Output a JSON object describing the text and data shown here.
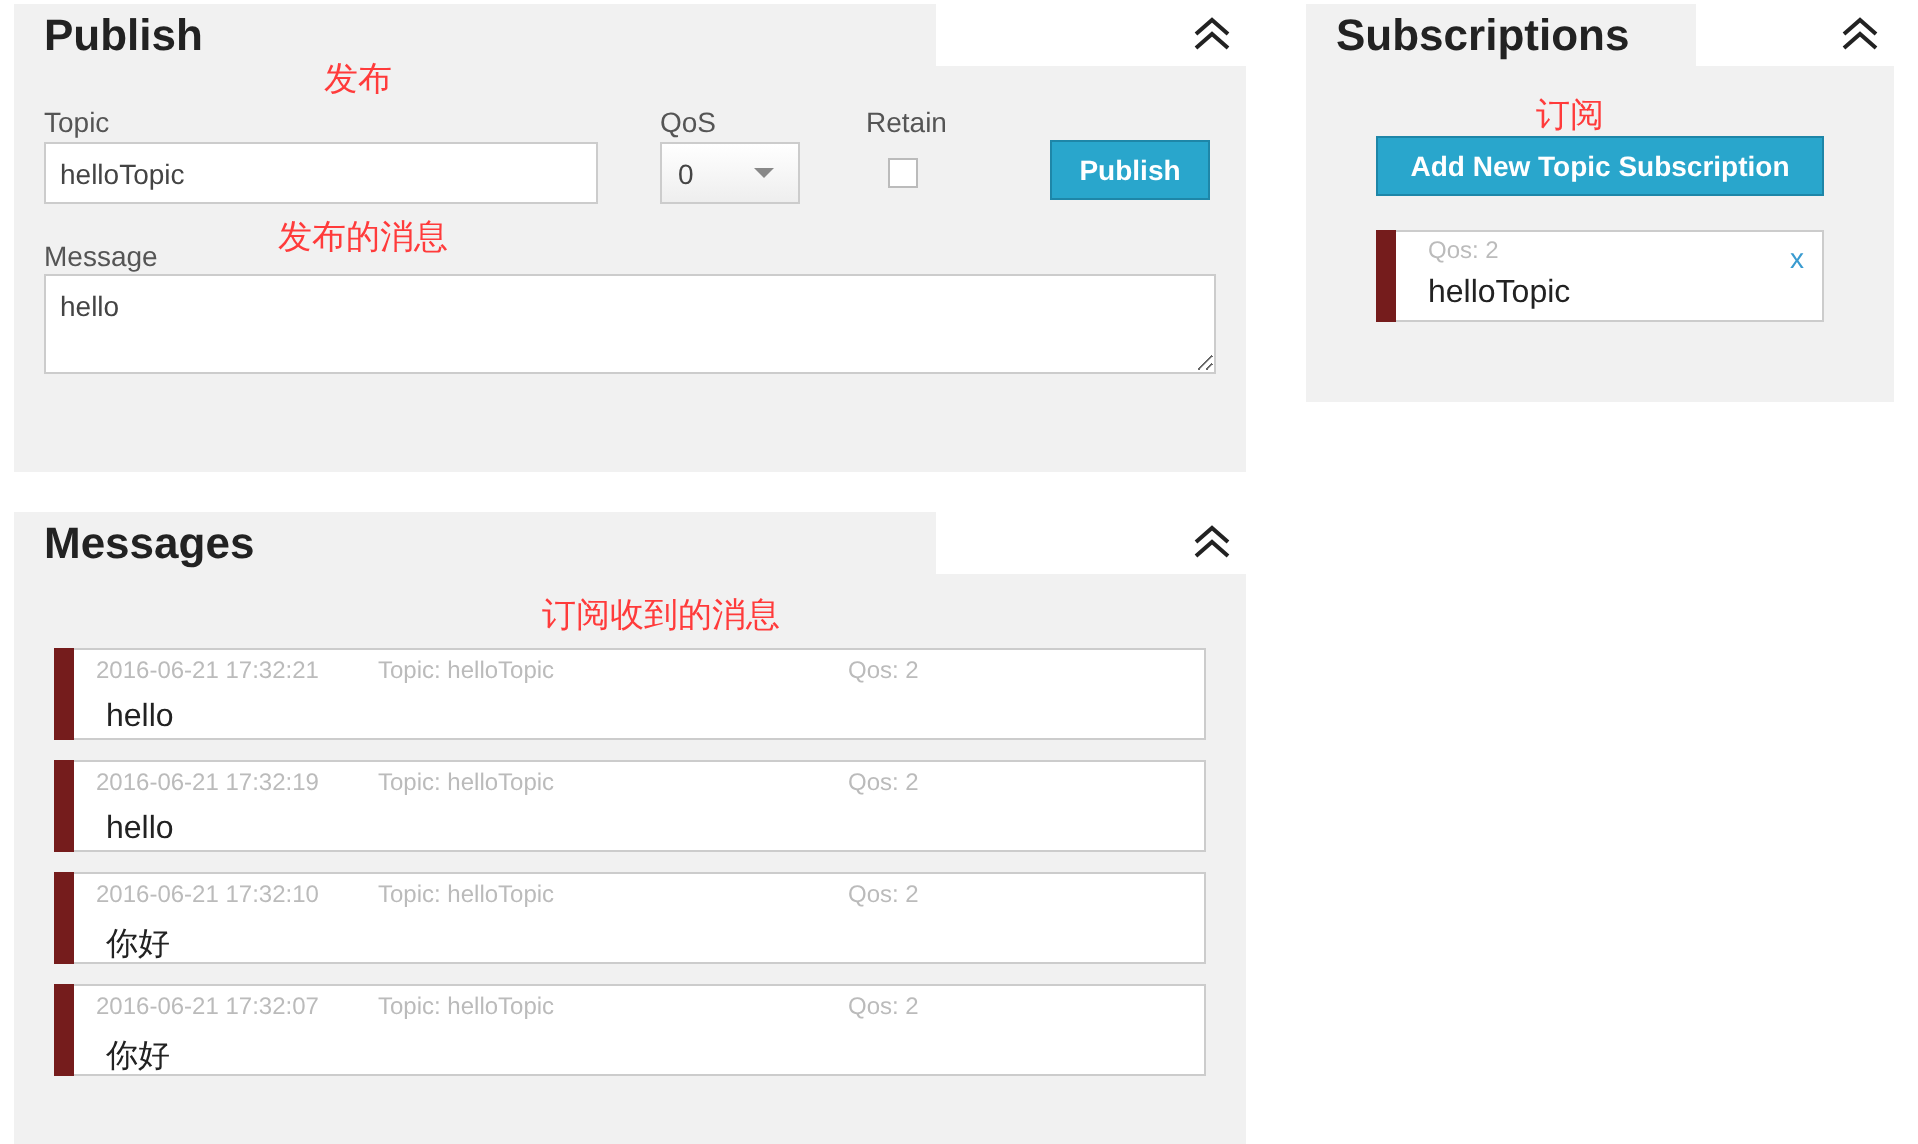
{
  "publish": {
    "title": "Publish",
    "annotation": "发布",
    "topic": {
      "label": "Topic",
      "value": "helloTopic"
    },
    "qos": {
      "label": "QoS",
      "value": "0"
    },
    "retain": {
      "label": "Retain",
      "checked": false
    },
    "button": "Publish",
    "message": {
      "label": "Message",
      "value": "hello",
      "annotation": "发布的消息"
    }
  },
  "subscriptions": {
    "title": "Subscriptions",
    "annotation": "订阅",
    "button": "Add New Topic Subscription",
    "items": [
      {
        "qos": "Qos: 2",
        "topic": "helloTopic",
        "remove": "x",
        "color": "#751c1c"
      }
    ]
  },
  "messages": {
    "title": "Messages",
    "annotation": "订阅收到的消息",
    "items": [
      {
        "time": "2016-06-21 17:32:21",
        "topic": "Topic: helloTopic",
        "qos": "Qos: 2",
        "payload": "hello",
        "color": "#751c1c"
      },
      {
        "time": "2016-06-21 17:32:19",
        "topic": "Topic: helloTopic",
        "qos": "Qos: 2",
        "payload": "hello",
        "color": "#751c1c"
      },
      {
        "time": "2016-06-21 17:32:10",
        "topic": "Topic: helloTopic",
        "qos": "Qos: 2",
        "payload": "你好",
        "color": "#751c1c"
      },
      {
        "time": "2016-06-21 17:32:07",
        "topic": "Topic: helloTopic",
        "qos": "Qos: 2",
        "payload": "你好",
        "color": "#751c1c"
      }
    ]
  }
}
